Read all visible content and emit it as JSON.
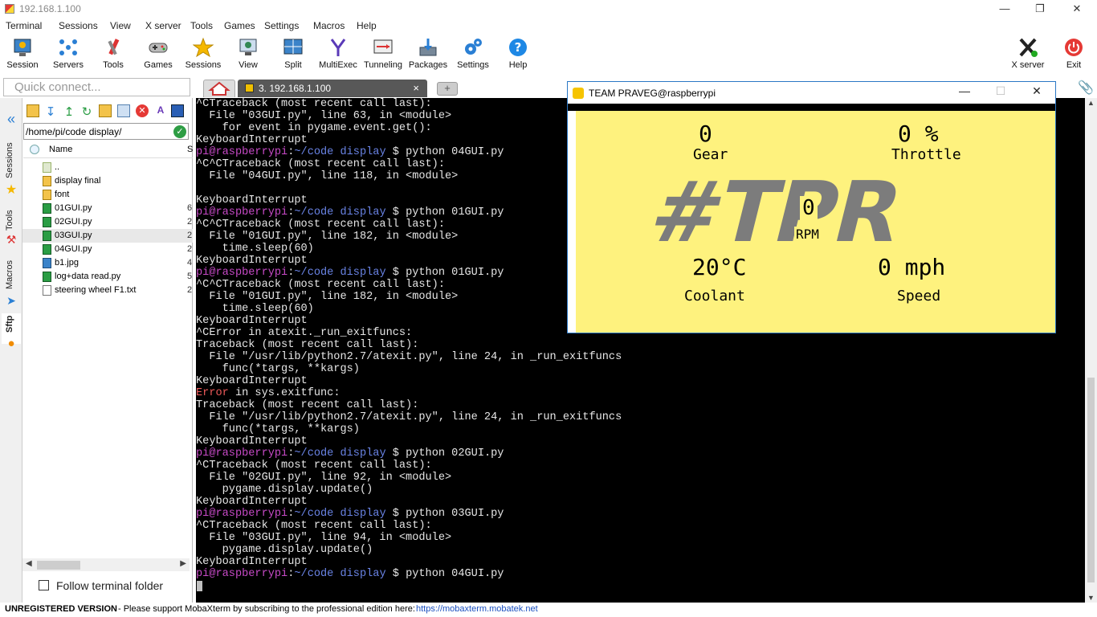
{
  "window": {
    "title": "192.168.1.100"
  },
  "menu": [
    "Terminal",
    "Sessions",
    "View",
    "X server",
    "Tools",
    "Games",
    "Settings",
    "Macros",
    "Help"
  ],
  "toolbar": {
    "left": [
      {
        "label": "Session",
        "icon": "session-icon"
      },
      {
        "label": "Servers",
        "icon": "servers-icon"
      },
      {
        "label": "Tools",
        "icon": "tools-icon"
      },
      {
        "label": "Games",
        "icon": "games-icon"
      },
      {
        "label": "Sessions",
        "icon": "star-icon"
      },
      {
        "label": "View",
        "icon": "view-icon"
      },
      {
        "label": "Split",
        "icon": "split-icon"
      },
      {
        "label": "MultiExec",
        "icon": "multiexec-icon"
      },
      {
        "label": "Tunneling",
        "icon": "tunneling-icon"
      },
      {
        "label": "Packages",
        "icon": "packages-icon"
      },
      {
        "label": "Settings",
        "icon": "settings-icon"
      },
      {
        "label": "Help",
        "icon": "help-icon"
      }
    ],
    "right": [
      {
        "label": "X server",
        "icon": "xserver-icon"
      },
      {
        "label": "Exit",
        "icon": "exit-icon"
      }
    ]
  },
  "quick_connect": {
    "placeholder": "Quick connect..."
  },
  "tabs": {
    "session_label": "3. 192.168.1.100",
    "close": "×",
    "new": "+"
  },
  "side_tabs": [
    "Sessions",
    "Tools",
    "Macros",
    "Sftp"
  ],
  "sftp": {
    "path": "/home/pi/code display/",
    "column_name": "Name",
    "column_size": "S",
    "files": [
      {
        "name": "..",
        "type": "up"
      },
      {
        "name": "display final",
        "type": "folder"
      },
      {
        "name": "font",
        "type": "folder"
      },
      {
        "name": "01GUI.py",
        "type": "py",
        "extra": "6"
      },
      {
        "name": "02GUI.py",
        "type": "py",
        "extra": "2"
      },
      {
        "name": "03GUI.py",
        "type": "py",
        "extra": "2",
        "selected": true
      },
      {
        "name": "04GUI.py",
        "type": "py",
        "extra": "2"
      },
      {
        "name": "b1.jpg",
        "type": "img",
        "extra": "4"
      },
      {
        "name": "log+data read.py",
        "type": "py",
        "extra": "5"
      },
      {
        "name": "steering wheel F1.txt",
        "type": "txt",
        "extra": "2"
      }
    ],
    "follow_label": "Follow terminal folder"
  },
  "terminal": {
    "lines": [
      [
        {
          "t": "^CTraceback (most recent call last):"
        }
      ],
      [
        {
          "t": "  File \"03GUI.py\", line 63, in <module>"
        }
      ],
      [
        {
          "t": "    for event in pygame.event.get():"
        }
      ],
      [
        {
          "t": "KeyboardInterrupt"
        }
      ],
      [
        {
          "t": "pi@raspberrypi",
          "c": "tp"
        },
        {
          "t": ":"
        },
        {
          "t": "~/code display",
          "c": "tcwd"
        },
        {
          "t": " $ python 04GUI.py"
        }
      ],
      [
        {
          "t": "^C^CTraceback (most recent call last):"
        }
      ],
      [
        {
          "t": "  File \"04GUI.py\", line 118, in <module>"
        }
      ],
      [
        {
          "t": ""
        }
      ],
      [
        {
          "t": "KeyboardInterrupt"
        }
      ],
      [
        {
          "t": "pi@raspberrypi",
          "c": "tp"
        },
        {
          "t": ":"
        },
        {
          "t": "~/code display",
          "c": "tcwd"
        },
        {
          "t": " $ python 01GUI.py"
        }
      ],
      [
        {
          "t": "^C^CTraceback (most recent call last):"
        }
      ],
      [
        {
          "t": "  File \"01GUI.py\", line 182, in <module>"
        }
      ],
      [
        {
          "t": "    time.sleep(60)"
        }
      ],
      [
        {
          "t": "KeyboardInterrupt"
        }
      ],
      [
        {
          "t": "pi@raspberrypi",
          "c": "tp"
        },
        {
          "t": ":"
        },
        {
          "t": "~/code display",
          "c": "tcwd"
        },
        {
          "t": " $ python 01GUI.py"
        }
      ],
      [
        {
          "t": "^C^CTraceback (most recent call last):"
        }
      ],
      [
        {
          "t": "  File \"01GUI.py\", line 182, in <module>"
        }
      ],
      [
        {
          "t": "    time.sleep(60)"
        }
      ],
      [
        {
          "t": "KeyboardInterrupt"
        }
      ],
      [
        {
          "t": "^CError in atexit._run_exitfuncs:"
        }
      ],
      [
        {
          "t": "Traceback (most recent call last):"
        }
      ],
      [
        {
          "t": "  File \"/usr/lib/python2.7/atexit.py\", line 24, in _run_exitfuncs"
        }
      ],
      [
        {
          "t": "    func(*targs, **kargs)"
        }
      ],
      [
        {
          "t": "KeyboardInterrupt"
        }
      ],
      [
        {
          "t": "Error",
          "c": "terr"
        },
        {
          "t": " in sys.exitfunc:"
        }
      ],
      [
        {
          "t": "Traceback (most recent call last):"
        }
      ],
      [
        {
          "t": "  File \"/usr/lib/python2.7/atexit.py\", line 24, in _run_exitfuncs"
        }
      ],
      [
        {
          "t": "    func(*targs, **kargs)"
        }
      ],
      [
        {
          "t": "KeyboardInterrupt"
        }
      ],
      [
        {
          "t": "pi@raspberrypi",
          "c": "tp"
        },
        {
          "t": ":"
        },
        {
          "t": "~/code display",
          "c": "tcwd"
        },
        {
          "t": " $ python 02GUI.py"
        }
      ],
      [
        {
          "t": "^CTraceback (most recent call last):"
        }
      ],
      [
        {
          "t": "  File \"02GUI.py\", line 92, in <module>"
        }
      ],
      [
        {
          "t": "    pygame.display.update()"
        }
      ],
      [
        {
          "t": "KeyboardInterrupt"
        }
      ],
      [
        {
          "t": "pi@raspberrypi",
          "c": "tp"
        },
        {
          "t": ":"
        },
        {
          "t": "~/code display",
          "c": "tcwd"
        },
        {
          "t": " $ python 03GUI.py"
        }
      ],
      [
        {
          "t": "^CTraceback (most recent call last):"
        }
      ],
      [
        {
          "t": "  File \"03GUI.py\", line 94, in <module>"
        }
      ],
      [
        {
          "t": "    pygame.display.update()"
        }
      ],
      [
        {
          "t": "KeyboardInterrupt"
        }
      ],
      [
        {
          "t": "pi@raspberrypi",
          "c": "tp"
        },
        {
          "t": ":"
        },
        {
          "t": "~/code display",
          "c": "tcwd"
        },
        {
          "t": " $ python 04GUI.py"
        }
      ]
    ]
  },
  "pygame_window": {
    "title": "TEAM PRAVEG@raspberrypi",
    "gear_value": "0",
    "gear_label": "Gear",
    "throttle_value": "0 %",
    "throttle_label": "Throttle",
    "logo": "#TPR",
    "rpm_value": "0",
    "rpm_label": "RPM",
    "coolant_value": "20°C",
    "coolant_label": "Coolant",
    "speed_value": "0 mph",
    "speed_label": "Speed",
    "background_color": "#fef27e",
    "logo_color": "#7c7c7c"
  },
  "statusbar": {
    "unregistered": "UNREGISTERED VERSION",
    "message": "-  Please support MobaXterm by subscribing to the professional edition here:",
    "link": "https://mobaxterm.mobatek.net"
  }
}
